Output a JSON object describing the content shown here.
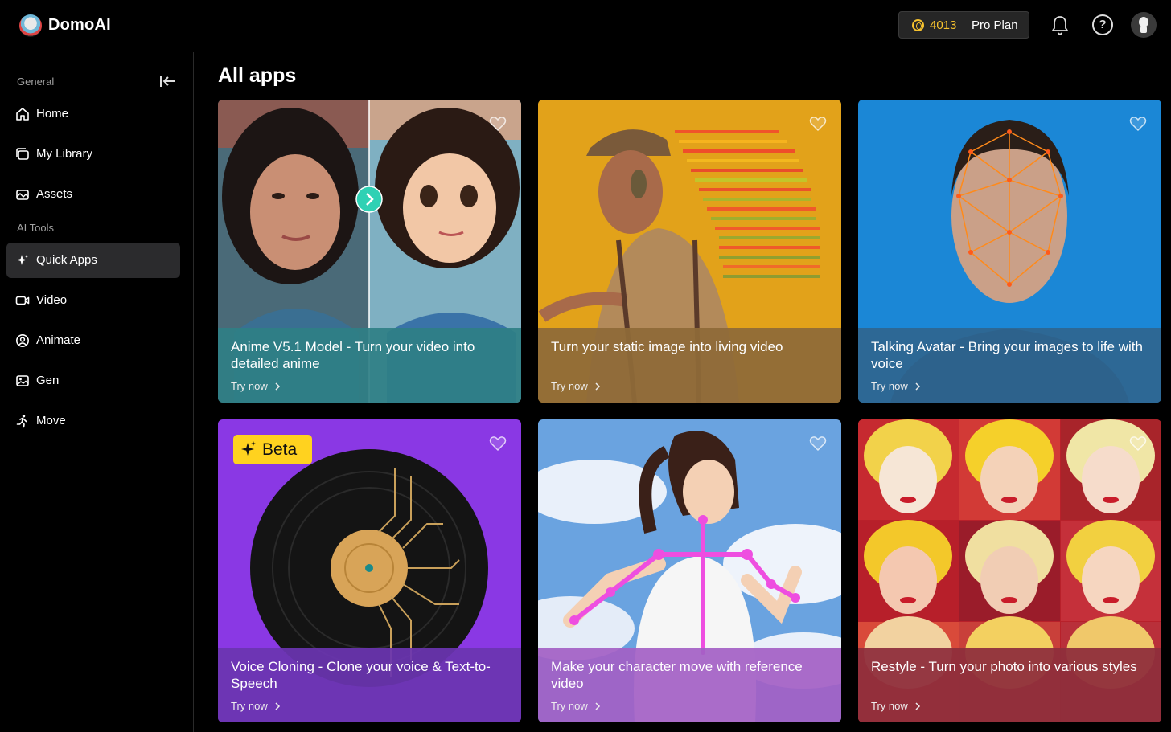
{
  "brand": {
    "name": "DomoAI"
  },
  "header": {
    "credits": "4013",
    "plan": "Pro Plan"
  },
  "sidebar": {
    "section_general": "General",
    "section_ai_tools": "AI Tools",
    "items": [
      {
        "label": "Home",
        "icon": "home-icon"
      },
      {
        "label": "My Library",
        "icon": "library-icon"
      },
      {
        "label": "Assets",
        "icon": "assets-icon"
      },
      {
        "label": "Quick Apps",
        "icon": "sparkle-icon",
        "active": true
      },
      {
        "label": "Video",
        "icon": "video-icon"
      },
      {
        "label": "Animate",
        "icon": "animate-icon"
      },
      {
        "label": "Gen",
        "icon": "image-icon"
      },
      {
        "label": "Move",
        "icon": "running-figure-icon"
      }
    ]
  },
  "main": {
    "title": "All apps",
    "try_label": "Try now",
    "badge": "Beta",
    "cards": [
      {
        "title": "Anime V5.1 Model - Turn your video into detailed anime",
        "overlay_color": "#2f7f86"
      },
      {
        "title": "Turn your static image into living video",
        "overlay_color": "#8e6a38"
      },
      {
        "title": "Talking Avatar - Bring your images to life with voice",
        "overlay_color": "#2e6691"
      },
      {
        "title": "Voice Cloning - Clone your voice & Text-to-Speech",
        "overlay_color": "#6b35b0"
      },
      {
        "title": "Make your character move with reference video",
        "overlay_color": "#a35fc4"
      },
      {
        "title": "Restyle - Turn your photo into various styles",
        "overlay_color": "#8e2e3c"
      }
    ]
  },
  "colors": {
    "accent_yellow": "#f6c22e",
    "active_bg": "#2b2b2d",
    "divider": "#2a2a2a"
  }
}
